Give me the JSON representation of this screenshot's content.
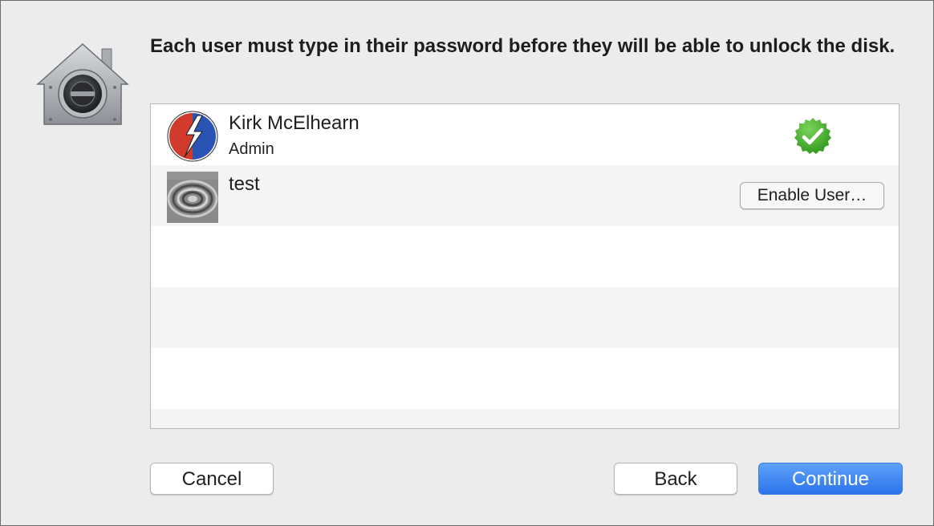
{
  "header": {
    "icon": "security-lock-icon",
    "message": "Each user must type in their password before they will be able to unlock the disk."
  },
  "users": [
    {
      "name": "Kirk McElhearn",
      "role": "Admin",
      "avatar": "steal-your-face-avatar",
      "status": "enabled",
      "status_icon": "green-check-icon"
    },
    {
      "name": "test",
      "role": "",
      "avatar": "zen-garden-avatar",
      "status": "disabled",
      "action_label": "Enable User…"
    }
  ],
  "buttons": {
    "cancel": "Cancel",
    "back": "Back",
    "continue": "Continue"
  },
  "colors": {
    "background": "#ececec",
    "primary_button": "#3b82f6",
    "check_green": "#3aa826"
  }
}
